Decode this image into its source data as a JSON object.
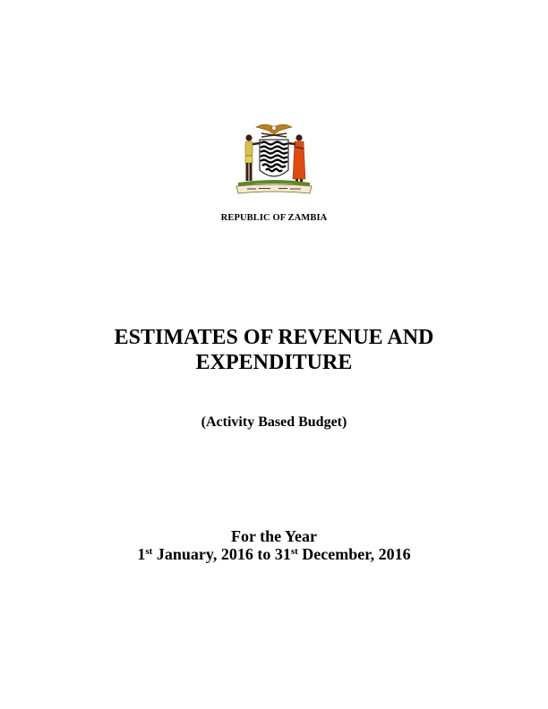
{
  "emblem": {
    "icon": "zambia-coat-of-arms-icon",
    "motto": "ONE ZAMBIA ONE NATION"
  },
  "header": {
    "country": "REPUBLIC OF ZAMBIA"
  },
  "document": {
    "title": "ESTIMATES OF REVENUE AND EXPENDITURE",
    "subtitle": "(Activity Based Budget)",
    "period_heading": "For the Year",
    "period": {
      "start_day": "1",
      "start_suffix": "st",
      "start_rest": " January, 2016 to 31",
      "end_suffix": "st",
      "end_rest": " December, 2016"
    }
  }
}
